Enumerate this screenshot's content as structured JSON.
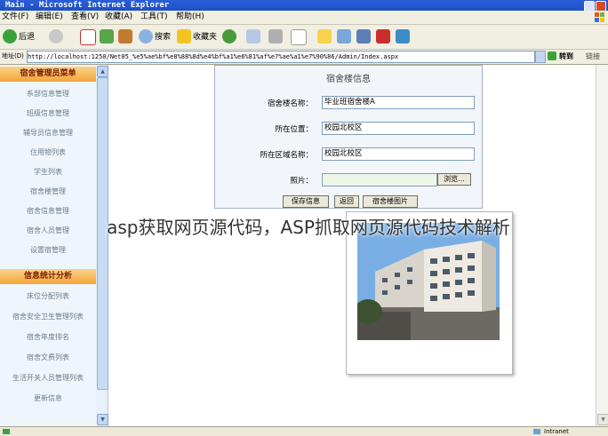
{
  "window": {
    "title": "Main - Microsoft Internet Explorer",
    "logo": "xp-flag-logo"
  },
  "menu": [
    "文件(F)",
    "编辑(E)",
    "查看(V)",
    "收藏(A)",
    "工具(T)",
    "帮助(H)"
  ],
  "toolbar": {
    "back": "后退",
    "search": "搜索",
    "favorites": "收藏夹"
  },
  "address": {
    "label": "地址(D)",
    "url": "http://localhost:1250/Net05_%e5%ae%bf%e8%88%8d%e4%bf%a1%e6%81%af%e7%ae%a1%e7%90%86/Admin/Index.aspx",
    "go": "转到",
    "links": "链接"
  },
  "sidebar": {
    "section1": "宿舍管理员菜单",
    "items1": [
      "系部信息管理",
      "班级信息管理",
      "辅导员信息管理",
      "住用物列表",
      "学生列表",
      "宿舍楼管理",
      "宿舍信息管理",
      "宿舍人员管理",
      "设置宿管理"
    ],
    "section2": "信息统计分析",
    "items2": [
      "床位分配列表",
      "宿舍安全卫生管理列表",
      "宿舍年度排名",
      "宿舍文费列表",
      "生活开关人员管理列表",
      "更新信息"
    ]
  },
  "form": {
    "title": "宿舍楼信息",
    "fields": [
      {
        "label": "宿舍楼名称：",
        "value": "毕业班宿舍楼A"
      },
      {
        "label": "所在位置：",
        "value": "校园北校区"
      },
      {
        "label": "所在区域名称：",
        "value": "校园北校区"
      }
    ],
    "photo_label": "照片：",
    "browse": "浏览...",
    "buttons": [
      "保存信息",
      "返回",
      "宿舍楼图片"
    ]
  },
  "overlay_caption": "asp获取网页源代码，ASP抓取网页源代码技术解析",
  "status": {
    "right": "Intranet"
  },
  "colors": {
    "titlebar": "#1e4fc3",
    "section_header": "#f3a43a",
    "sidebar_bg": "#eef6fb"
  }
}
